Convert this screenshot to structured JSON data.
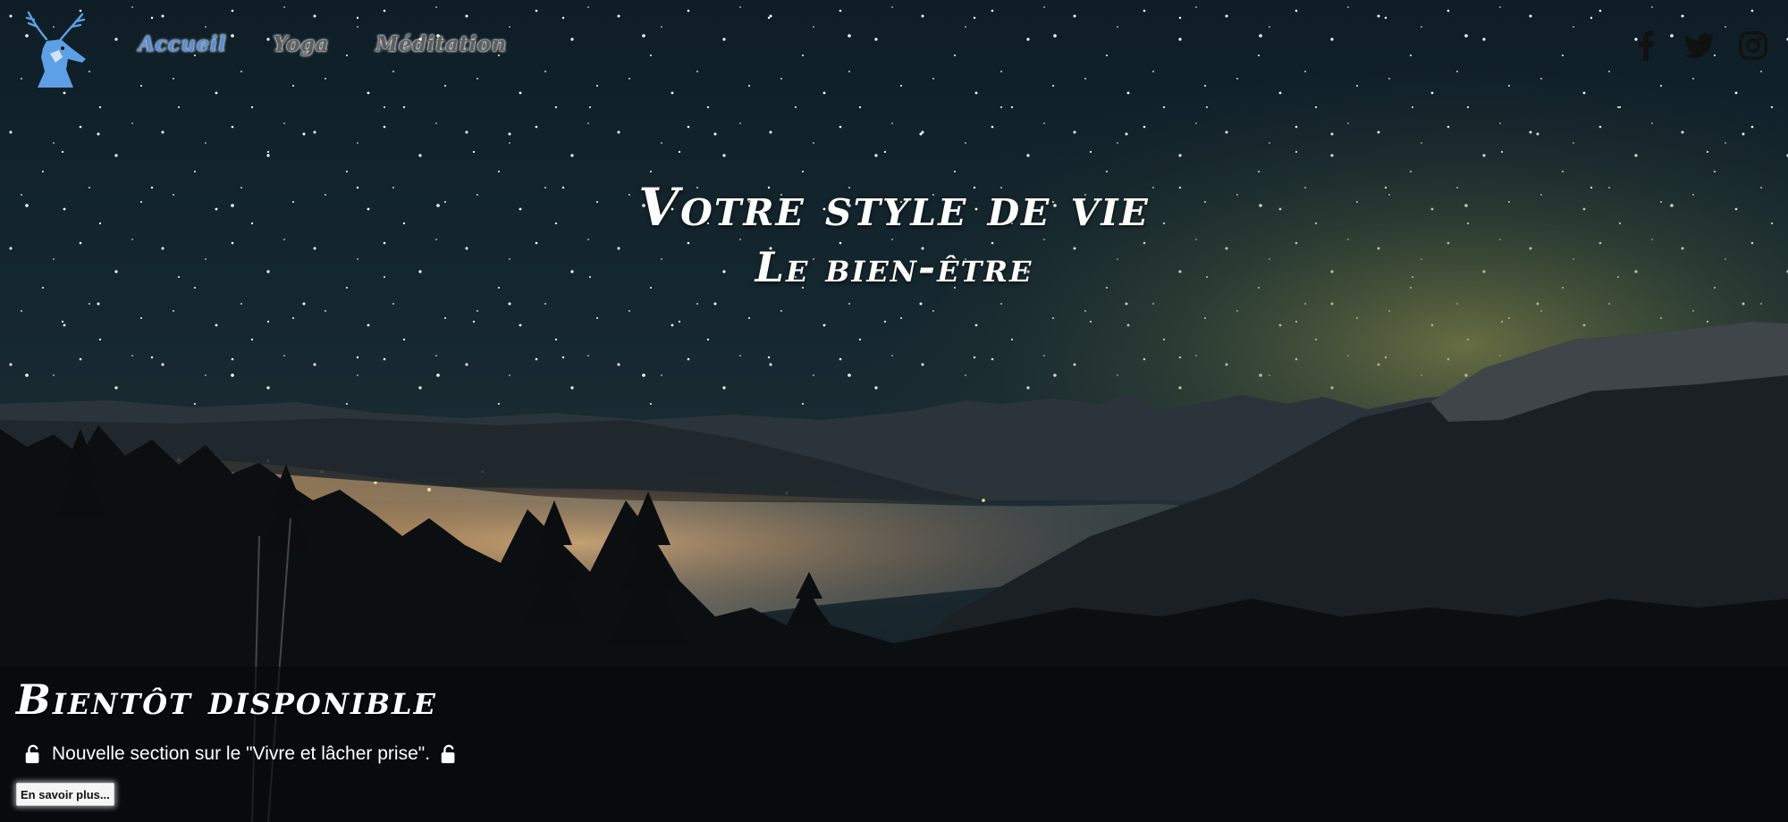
{
  "header": {
    "logo_icon": "deer-head-icon",
    "nav": [
      {
        "label": "Accueil",
        "active": true
      },
      {
        "label": "Yoga",
        "active": false
      },
      {
        "label": "Méditation",
        "active": false
      }
    ],
    "social": [
      {
        "name": "facebook",
        "icon": "facebook-icon"
      },
      {
        "name": "twitter",
        "icon": "twitter-icon"
      },
      {
        "name": "instagram",
        "icon": "instagram-icon"
      }
    ]
  },
  "hero": {
    "title": "Votre style de vie",
    "subtitle": "Le bien-être",
    "background": "starry-night-mountain-valley"
  },
  "banner": {
    "title": "Bientôt disponible",
    "text": "Nouvelle section sur le \"Vivre et lâcher prise\".",
    "icon_left": "unlock-icon",
    "icon_right": "unlock-icon",
    "button_label": "En savoir plus..."
  },
  "colors": {
    "nav_active": "#5b8fd6",
    "nav_inactive": "#5e5e5e",
    "logo_blue": "#5ea0e6",
    "text_white": "#ffffff",
    "social_icon": "#111111"
  }
}
